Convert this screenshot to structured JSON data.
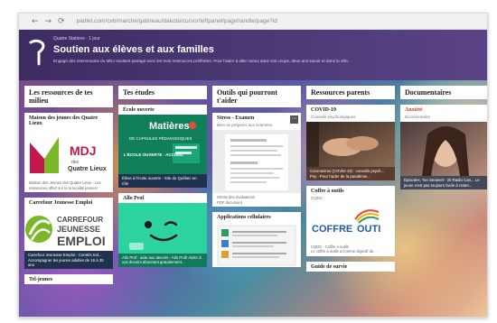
{
  "browser": {
    "back": "←",
    "forward": "→",
    "reload": "⟳",
    "url": "padlet.com/cvb/marche/gatineau/dakota/cursor/leftpanel/pagehandle/page?id"
  },
  "banner": {
    "breadcrumb": "Quatre Stations  ·  1 jour",
    "title": "Soutien aux élèves et aux familles",
    "description": "Engagé des intervenants du MDJ soutient partagé avec les trois ressources préférées. Pour l'aider à aller mieux dans vos coups, deux ans savoir et dans la ville."
  },
  "columns": [
    {
      "title": "Les ressources de tes milieu",
      "cards": [
        {
          "title": "Maison des jeunes des Quatre Lieux",
          "logo_text": "MDJ",
          "logo_sub": "des",
          "logo_place": "Quatre Lieux",
          "caption": "Maison des Jeunes des Quatre Lieux - Les ressources offert sur la la localité jeunes!"
        },
        {
          "title": "Carrefour Jeunesse Emploi",
          "logo_top": "CARREFOUR",
          "logo_mid": "JEUNESSE",
          "logo_bottom": "EMPLOI",
          "caption": "Carrefour Jeunesse Emploi - Comtés Ind... Accompagner les jeunes adultes de 16 à 35 ans"
        },
        {
          "title": "Tel-jeunes"
        }
      ]
    },
    {
      "title": "Tes études",
      "cards": [
        {
          "title": "École ouverte",
          "poster_title": "Matières",
          "poster_sub": "DE CAPSULES PÉDAGOGIQUES",
          "poster_foot": "L'ÉCOLE OUVERTE · ACCUEIL",
          "caption": "Élève à l'école ouverte - Site du Québec en rôle"
        },
        {
          "title": "Allo Prof",
          "caption": "Allo Prof · aide aux devoirs - Allo Prof! Aidez à vos devoirs abonnant gratuitement..."
        }
      ]
    },
    {
      "title": "Outils qui pourront t'aider",
      "cards": [
        {
          "title": "Stress - Examen",
          "subtitle": "Bien se préparer aux examens",
          "caption": "Stress des évaluations",
          "caption2": "PDF document"
        },
        {
          "title": "Applications cellulaires"
        }
      ]
    },
    {
      "title": "Ressources parents",
      "cards": [
        {
          "title": "COVID-19",
          "subtitle": "Conseils psychologiques",
          "caption": "Coronavirus (COVID-19) : conseils psych... Psy - Pour l'aider de la pandémie..."
        },
        {
          "title": "Coffre à outils",
          "subtitle": "CQDC",
          "logo_a": "COFFRE",
          "logo_b": "OUTI",
          "caption": "CQDC - Coffre à outils",
          "caption2": "Le coffre à outils a comme objectif de..."
        },
        {
          "title": "Guide de survie"
        }
      ]
    },
    {
      "title": "Documentaires",
      "cards": [
        {
          "title": "Anxiété",
          "subtitle": "Documentaire",
          "caption": "Épisodes, Ton Seraient : 20 Radio Can... Le jeune s'est pas toujours facile à rester..."
        }
      ]
    }
  ],
  "colors": {
    "banner": "#4a3a72",
    "mdj_red": "#c4174d",
    "mdj_green": "#7bb828",
    "poster_green": "#128b62",
    "allo_green": "#2cd39f",
    "coffre_blue": "#1e5aa8"
  }
}
